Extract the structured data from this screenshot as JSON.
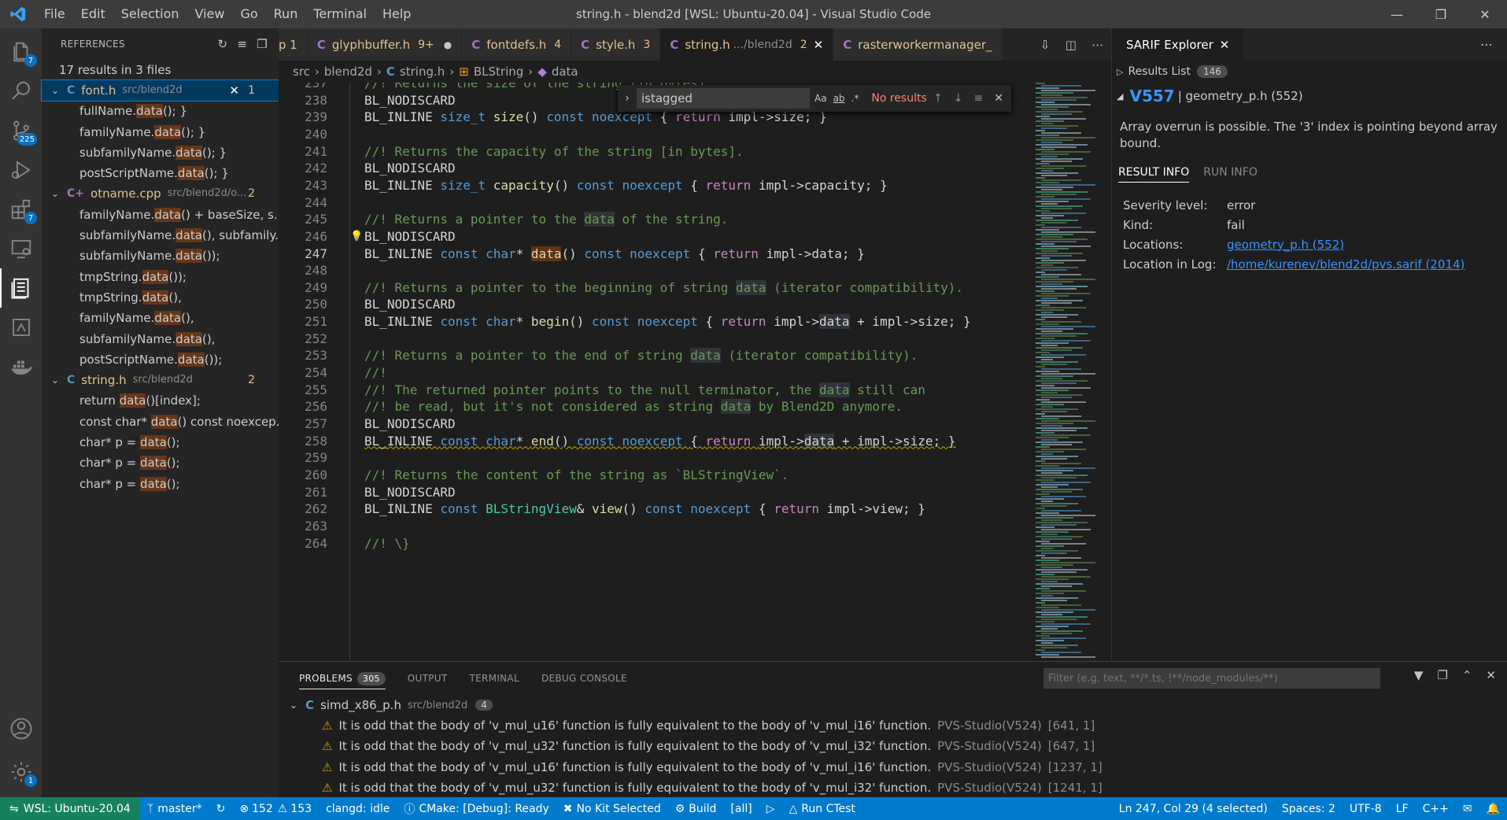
{
  "window": {
    "title": "string.h - blend2d [WSL: Ubuntu-20.04] - Visual Studio Code",
    "menu": [
      "File",
      "Edit",
      "Selection",
      "View",
      "Go",
      "Run",
      "Terminal",
      "Help"
    ]
  },
  "activity": {
    "explorer_badge": "7",
    "scm_badge": "225",
    "extensions_badge": "7",
    "settings_badge": "1"
  },
  "sidebar": {
    "title": "REFERENCES",
    "summary": "17 results in 3 files",
    "groups": [
      {
        "type": "C",
        "name": "font.h",
        "path": "src/blend2d",
        "count": "1",
        "items": [
          {
            "pre": "fullName.",
            "hl": "data",
            "post": "(); }"
          },
          {
            "pre": "familyName.",
            "hl": "data",
            "post": "(); }"
          },
          {
            "pre": "subfamilyName.",
            "hl": "data",
            "post": "(); }"
          },
          {
            "pre": "postScriptName.",
            "hl": "data",
            "post": "(); }"
          }
        ]
      },
      {
        "type": "C+",
        "name": "otname.cpp",
        "path": "src/blend2d/o...",
        "count": "2",
        "items": [
          {
            "pre": "familyName.",
            "hl": "data",
            "post": "() + baseSize, s..."
          },
          {
            "pre": "subfamilyName.",
            "hl": "data",
            "post": "(), subfamily..."
          },
          {
            "pre": "subfamilyName.",
            "hl": "data",
            "post": "());"
          },
          {
            "pre": "tmpString.",
            "hl": "data",
            "post": "());"
          },
          {
            "pre": "tmpString.",
            "hl": "data",
            "post": "(),"
          },
          {
            "pre": "familyName.",
            "hl": "data",
            "post": "(),"
          },
          {
            "pre": "subfamilyName.",
            "hl": "data",
            "post": "(),"
          },
          {
            "pre": "postScriptName.",
            "hl": "data",
            "post": "());"
          }
        ]
      },
      {
        "type": "C",
        "name": "string.h",
        "path": "src/blend2d",
        "count": "2",
        "items": [
          {
            "pre": "return ",
            "hl": "data",
            "post": "()[index];"
          },
          {
            "pre": "const char* ",
            "hl": "data",
            "post": "() const noexcep..."
          },
          {
            "pre": "char* p = ",
            "hl": "data",
            "post": "();"
          },
          {
            "pre": "char* p = ",
            "hl": "data",
            "post": "();"
          },
          {
            "pre": "char* p = ",
            "hl": "data",
            "post": "();"
          }
        ]
      }
    ]
  },
  "tabs": [
    {
      "icon": "",
      "name": "p 1",
      "num": "",
      "extra": ""
    },
    {
      "icon": "C",
      "name": "glyphbuffer.h",
      "num": "9+",
      "extra": "●"
    },
    {
      "icon": "C",
      "name": "fontdefs.h",
      "num": "4",
      "extra": ""
    },
    {
      "icon": "C",
      "name": "style.h",
      "num": "3",
      "extra": ""
    },
    {
      "icon": "C",
      "name": "string.h",
      "path": ".../blend2d",
      "num": "2",
      "extra": "✕",
      "active": true
    },
    {
      "icon": "C",
      "name": "rasterworkermanager_",
      "num": "",
      "extra": ""
    }
  ],
  "breadcrumb": [
    "src",
    "blend2d",
    "string.h",
    "BLString",
    "data"
  ],
  "find": {
    "value": "istagged",
    "no_results": "No results"
  },
  "editor": {
    "lines": [
      {
        "n": "237",
        "code": [
          [
            "c-cm",
            "//! Returns the size of the string [in bytes]."
          ]
        ]
      },
      {
        "n": "238",
        "code": [
          [
            "c-mac",
            "BL_NODISCARD"
          ]
        ]
      },
      {
        "n": "239",
        "code": [
          [
            "c-mac",
            "BL_INLINE "
          ],
          [
            "c-kw",
            "size_t "
          ],
          [
            "c-fn",
            "size"
          ],
          [
            "c-id",
            "() "
          ],
          [
            "c-kw",
            "const noexcept "
          ],
          [
            "c-id",
            "{ "
          ],
          [
            "c-ctl",
            "return "
          ],
          [
            "c-id",
            "impl->size; }"
          ]
        ]
      },
      {
        "n": "240",
        "code": []
      },
      {
        "n": "241",
        "code": [
          [
            "c-cm",
            "//! Returns the capacity of the string [in bytes]."
          ]
        ]
      },
      {
        "n": "242",
        "code": [
          [
            "c-mac",
            "BL_NODISCARD"
          ]
        ]
      },
      {
        "n": "243",
        "code": [
          [
            "c-mac",
            "BL_INLINE "
          ],
          [
            "c-kw",
            "size_t "
          ],
          [
            "c-fn",
            "capacity"
          ],
          [
            "c-id",
            "() "
          ],
          [
            "c-kw",
            "const noexcept "
          ],
          [
            "c-id",
            "{ "
          ],
          [
            "c-ctl",
            "return "
          ],
          [
            "c-id",
            "impl->capacity; }"
          ]
        ]
      },
      {
        "n": "244",
        "code": []
      },
      {
        "n": "245",
        "code": [
          [
            "c-cm",
            "//! Returns a pointer to the "
          ],
          [
            "c-cm c-dhl",
            "data"
          ],
          [
            "c-cm",
            " of the string."
          ]
        ]
      },
      {
        "n": "246",
        "code": [
          [
            "c-mac",
            "BL_NODISCARD"
          ]
        ],
        "bulb": true
      },
      {
        "n": "247",
        "code": [
          [
            "c-mac",
            "BL_INLINE "
          ],
          [
            "c-kw",
            "const char"
          ],
          [
            "c-id",
            "* "
          ],
          [
            "c-fn c-sel",
            "data"
          ],
          [
            "c-id",
            "() "
          ],
          [
            "c-kw",
            "const noexcept "
          ],
          [
            "c-id",
            "{ "
          ],
          [
            "c-ctl",
            "return "
          ],
          [
            "c-id",
            "impl->data; }"
          ]
        ],
        "current": true
      },
      {
        "n": "248",
        "code": []
      },
      {
        "n": "249",
        "code": [
          [
            "c-cm",
            "//! Returns a pointer to the beginning of string "
          ],
          [
            "c-cm c-dhl",
            "data"
          ],
          [
            "c-cm",
            " (iterator compatibility)."
          ]
        ]
      },
      {
        "n": "250",
        "code": [
          [
            "c-mac",
            "BL_NODISCARD"
          ]
        ]
      },
      {
        "n": "251",
        "code": [
          [
            "c-mac",
            "BL_INLINE "
          ],
          [
            "c-kw",
            "const char"
          ],
          [
            "c-id",
            "* "
          ],
          [
            "c-fn",
            "begin"
          ],
          [
            "c-id",
            "() "
          ],
          [
            "c-kw",
            "const noexcept "
          ],
          [
            "c-id",
            "{ "
          ],
          [
            "c-ctl",
            "return "
          ],
          [
            "c-id",
            "impl->"
          ],
          [
            "c-id c-dhl",
            "data"
          ],
          [
            "c-id",
            " + impl->size; }"
          ]
        ]
      },
      {
        "n": "252",
        "code": []
      },
      {
        "n": "253",
        "code": [
          [
            "c-cm",
            "//! Returns a pointer to the end of string "
          ],
          [
            "c-cm c-dhl",
            "data"
          ],
          [
            "c-cm",
            " (iterator compatibility)."
          ]
        ]
      },
      {
        "n": "254",
        "code": [
          [
            "c-cm",
            "//!"
          ]
        ]
      },
      {
        "n": "255",
        "code": [
          [
            "c-cm",
            "//! The returned pointer points to the null terminator, the "
          ],
          [
            "c-cm c-dhl",
            "data"
          ],
          [
            "c-cm",
            " still can"
          ]
        ]
      },
      {
        "n": "256",
        "code": [
          [
            "c-cm",
            "//! be read, but it's not considered as string "
          ],
          [
            "c-cm c-dhl",
            "data"
          ],
          [
            "c-cm",
            " by Blend2D anymore."
          ]
        ]
      },
      {
        "n": "257",
        "code": [
          [
            "c-mac",
            "BL_NODISCARD"
          ]
        ]
      },
      {
        "n": "258",
        "code": [
          [
            "c-mac",
            "BL_INLINE "
          ],
          [
            "c-kw",
            "const char"
          ],
          [
            "c-id",
            "* "
          ],
          [
            "c-fn",
            "end"
          ],
          [
            "c-id",
            "() "
          ],
          [
            "c-kw",
            "const noexcept "
          ],
          [
            "c-id",
            "{ "
          ],
          [
            "c-ctl",
            "return "
          ],
          [
            "c-id",
            "impl->"
          ],
          [
            "c-id c-dhl",
            "data"
          ],
          [
            "c-id",
            " + impl->size; }"
          ]
        ],
        "squiggle": true
      },
      {
        "n": "259",
        "code": []
      },
      {
        "n": "260",
        "code": [
          [
            "c-cm",
            "//! Returns the content of the string as `BLStringView`."
          ]
        ]
      },
      {
        "n": "261",
        "code": [
          [
            "c-mac",
            "BL_NODISCARD"
          ]
        ]
      },
      {
        "n": "262",
        "code": [
          [
            "c-mac",
            "BL_INLINE "
          ],
          [
            "c-kw",
            "const "
          ],
          [
            "c-ty",
            "BLStringView"
          ],
          [
            "c-id",
            "& "
          ],
          [
            "c-fn",
            "view"
          ],
          [
            "c-id",
            "() "
          ],
          [
            "c-kw",
            "const noexcept "
          ],
          [
            "c-id",
            "{ "
          ],
          [
            "c-ctl",
            "return "
          ],
          [
            "c-id",
            "impl->view; }"
          ]
        ]
      },
      {
        "n": "263",
        "code": []
      },
      {
        "n": "264",
        "code": [
          [
            "c-cm",
            "//! \\}"
          ]
        ]
      }
    ]
  },
  "sarif": {
    "tab_title": "SARIF Explorer",
    "results_label": "Results List",
    "results_count": "146",
    "rule_id": "V557",
    "rule_file": "| geometry_p.h (552)",
    "message": "Array overrun is possible. The '3' index is pointing beyond array bound.",
    "tab_result": "RESULT INFO",
    "tab_run": "RUN INFO",
    "info": {
      "severity_k": "Severity level:",
      "severity_v": "error",
      "kind_k": "Kind:",
      "kind_v": "fail",
      "loc_k": "Locations:",
      "loc_v": "geometry_p.h (552)",
      "log_k": "Location in Log:",
      "log_v": "/home/kurenev/blend2d/pvs.sarif (2014)"
    }
  },
  "panel": {
    "tabs": {
      "problems": "PROBLEMS",
      "problems_count": "305",
      "output": "OUTPUT",
      "terminal": "TERMINAL",
      "debug": "DEBUG CONSOLE"
    },
    "filter_placeholder": "Filter (e.g. text, **/*.ts, !**/node_modules/**)",
    "file": {
      "name": "simd_x86_p.h",
      "path": "src/blend2d",
      "count": "4"
    },
    "problems": [
      {
        "msg": "It is odd that the body of 'v_mul_u16' function is fully equivalent to the body of 'v_mul_i16' function.",
        "src": "PVS-Studio(V524)",
        "loc": "[641, 1]"
      },
      {
        "msg": "It is odd that the body of 'v_mul_u32' function is fully equivalent to the body of 'v_mul_i32' function.",
        "src": "PVS-Studio(V524)",
        "loc": "[647, 1]"
      },
      {
        "msg": "It is odd that the body of 'v_mul_u16' function is fully equivalent to the body of 'v_mul_i16' function.",
        "src": "PVS-Studio(V524)",
        "loc": "[1237, 1]"
      },
      {
        "msg": "It is odd that the body of 'v_mul_u32' function is fully equivalent to the body of 'v_mul_i32' function.",
        "src": "PVS-Studio(V524)",
        "loc": "[1241, 1]"
      }
    ]
  },
  "status": {
    "remote": "WSL: Ubuntu-20.04",
    "branch": "master*",
    "errors": "152",
    "warnings": "153",
    "clangd": "clangd: idle",
    "cmake": "CMake: [Debug]: Ready",
    "kit": "No Kit Selected",
    "build": "Build",
    "target": "[all]",
    "ctest": "Run CTest",
    "position": "Ln 247, Col 29 (4 selected)",
    "spaces": "Spaces: 2",
    "encoding": "UTF-8",
    "eol": "LF",
    "lang": "C++"
  }
}
